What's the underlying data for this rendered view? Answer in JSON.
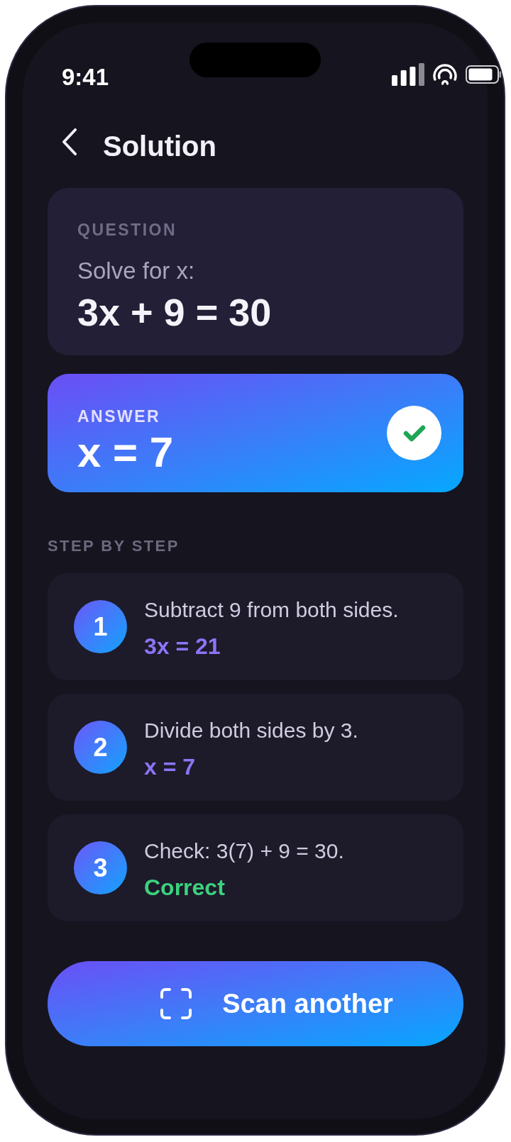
{
  "status_bar": {
    "time": "9:41"
  },
  "header": {
    "title": "Solution"
  },
  "question": {
    "label": "QUESTION",
    "prompt": "Solve for x:",
    "equation": "3x + 9 = 30"
  },
  "answer": {
    "label": "ANSWER",
    "value": "x = 7",
    "verified": true
  },
  "steps_section": {
    "heading": "STEP BY STEP",
    "steps": [
      {
        "number": "1",
        "text": "Subtract 9 from both sides.",
        "result": "3x = 21",
        "kind": "equation"
      },
      {
        "number": "2",
        "text": "Divide both sides by 3.",
        "result": "x = 7",
        "kind": "equation"
      },
      {
        "number": "3",
        "text": "Check: 3(7) + 9 = 30.",
        "result": "Correct",
        "kind": "verdict"
      }
    ]
  },
  "primary_button": {
    "label": "Scan another"
  }
}
